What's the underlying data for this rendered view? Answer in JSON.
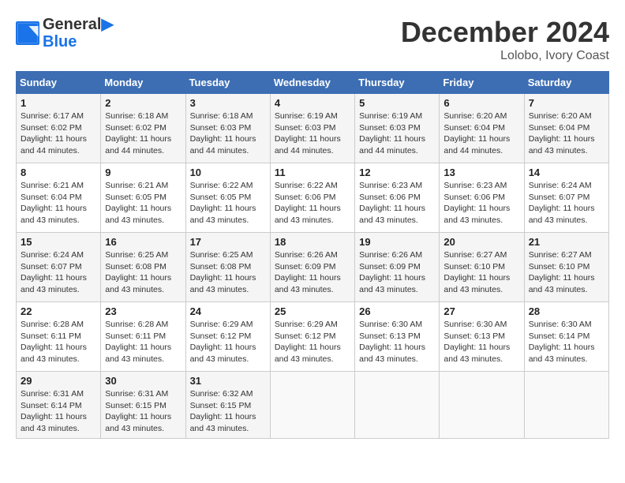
{
  "header": {
    "logo_line1": "General",
    "logo_line2": "Blue",
    "month_title": "December 2024",
    "location": "Lolobo, Ivory Coast"
  },
  "days_of_week": [
    "Sunday",
    "Monday",
    "Tuesday",
    "Wednesday",
    "Thursday",
    "Friday",
    "Saturday"
  ],
  "weeks": [
    [
      {
        "day": "1",
        "sunrise": "6:17 AM",
        "sunset": "6:02 PM",
        "daylight": "11 hours and 44 minutes."
      },
      {
        "day": "2",
        "sunrise": "6:18 AM",
        "sunset": "6:02 PM",
        "daylight": "11 hours and 44 minutes."
      },
      {
        "day": "3",
        "sunrise": "6:18 AM",
        "sunset": "6:03 PM",
        "daylight": "11 hours and 44 minutes."
      },
      {
        "day": "4",
        "sunrise": "6:19 AM",
        "sunset": "6:03 PM",
        "daylight": "11 hours and 44 minutes."
      },
      {
        "day": "5",
        "sunrise": "6:19 AM",
        "sunset": "6:03 PM",
        "daylight": "11 hours and 44 minutes."
      },
      {
        "day": "6",
        "sunrise": "6:20 AM",
        "sunset": "6:04 PM",
        "daylight": "11 hours and 44 minutes."
      },
      {
        "day": "7",
        "sunrise": "6:20 AM",
        "sunset": "6:04 PM",
        "daylight": "11 hours and 43 minutes."
      }
    ],
    [
      {
        "day": "8",
        "sunrise": "6:21 AM",
        "sunset": "6:04 PM",
        "daylight": "11 hours and 43 minutes."
      },
      {
        "day": "9",
        "sunrise": "6:21 AM",
        "sunset": "6:05 PM",
        "daylight": "11 hours and 43 minutes."
      },
      {
        "day": "10",
        "sunrise": "6:22 AM",
        "sunset": "6:05 PM",
        "daylight": "11 hours and 43 minutes."
      },
      {
        "day": "11",
        "sunrise": "6:22 AM",
        "sunset": "6:06 PM",
        "daylight": "11 hours and 43 minutes."
      },
      {
        "day": "12",
        "sunrise": "6:23 AM",
        "sunset": "6:06 PM",
        "daylight": "11 hours and 43 minutes."
      },
      {
        "day": "13",
        "sunrise": "6:23 AM",
        "sunset": "6:06 PM",
        "daylight": "11 hours and 43 minutes."
      },
      {
        "day": "14",
        "sunrise": "6:24 AM",
        "sunset": "6:07 PM",
        "daylight": "11 hours and 43 minutes."
      }
    ],
    [
      {
        "day": "15",
        "sunrise": "6:24 AM",
        "sunset": "6:07 PM",
        "daylight": "11 hours and 43 minutes."
      },
      {
        "day": "16",
        "sunrise": "6:25 AM",
        "sunset": "6:08 PM",
        "daylight": "11 hours and 43 minutes."
      },
      {
        "day": "17",
        "sunrise": "6:25 AM",
        "sunset": "6:08 PM",
        "daylight": "11 hours and 43 minutes."
      },
      {
        "day": "18",
        "sunrise": "6:26 AM",
        "sunset": "6:09 PM",
        "daylight": "11 hours and 43 minutes."
      },
      {
        "day": "19",
        "sunrise": "6:26 AM",
        "sunset": "6:09 PM",
        "daylight": "11 hours and 43 minutes."
      },
      {
        "day": "20",
        "sunrise": "6:27 AM",
        "sunset": "6:10 PM",
        "daylight": "11 hours and 43 minutes."
      },
      {
        "day": "21",
        "sunrise": "6:27 AM",
        "sunset": "6:10 PM",
        "daylight": "11 hours and 43 minutes."
      }
    ],
    [
      {
        "day": "22",
        "sunrise": "6:28 AM",
        "sunset": "6:11 PM",
        "daylight": "11 hours and 43 minutes."
      },
      {
        "day": "23",
        "sunrise": "6:28 AM",
        "sunset": "6:11 PM",
        "daylight": "11 hours and 43 minutes."
      },
      {
        "day": "24",
        "sunrise": "6:29 AM",
        "sunset": "6:12 PM",
        "daylight": "11 hours and 43 minutes."
      },
      {
        "day": "25",
        "sunrise": "6:29 AM",
        "sunset": "6:12 PM",
        "daylight": "11 hours and 43 minutes."
      },
      {
        "day": "26",
        "sunrise": "6:30 AM",
        "sunset": "6:13 PM",
        "daylight": "11 hours and 43 minutes."
      },
      {
        "day": "27",
        "sunrise": "6:30 AM",
        "sunset": "6:13 PM",
        "daylight": "11 hours and 43 minutes."
      },
      {
        "day": "28",
        "sunrise": "6:30 AM",
        "sunset": "6:14 PM",
        "daylight": "11 hours and 43 minutes."
      }
    ],
    [
      {
        "day": "29",
        "sunrise": "6:31 AM",
        "sunset": "6:14 PM",
        "daylight": "11 hours and 43 minutes."
      },
      {
        "day": "30",
        "sunrise": "6:31 AM",
        "sunset": "6:15 PM",
        "daylight": "11 hours and 43 minutes."
      },
      {
        "day": "31",
        "sunrise": "6:32 AM",
        "sunset": "6:15 PM",
        "daylight": "11 hours and 43 minutes."
      },
      null,
      null,
      null,
      null
    ]
  ]
}
